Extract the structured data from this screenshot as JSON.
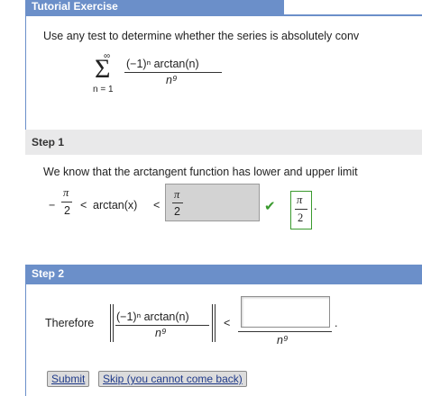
{
  "header": {
    "title": "Tutorial Exercise"
  },
  "problem": {
    "instruction": "Use any test to determine whether the series is absolutely conv",
    "sigma": "Σ",
    "upper": "∞",
    "lower": "n = 1",
    "numerator": "(−1)ⁿ arctan(n)",
    "denominator": "n⁹"
  },
  "step1": {
    "title": "Step 1",
    "text": "We know that the arctangent function has lower and upper limit",
    "neg": "−",
    "pi": "π",
    "two": "2",
    "lt1": "<",
    "arctan": "arctan(x)",
    "lt2": "<",
    "answer_num": "π",
    "answer_den": "2",
    "check": "✔",
    "hint_num": "π",
    "hint_den": "2",
    "period": "."
  },
  "step2": {
    "title": "Step 2",
    "therefore": "Therefore",
    "numerator": "(−1)ⁿ arctan(n)",
    "denominator": "n⁹",
    "lt": "<",
    "input_value": "",
    "rhs_den": "n⁹",
    "period": "."
  },
  "buttons": {
    "submit": "Submit",
    "skip": "Skip (you cannot come back)"
  },
  "colors": {
    "accent": "#6b8fc9",
    "check": "#3a9a2e",
    "answer_box": "#d3d3d3"
  }
}
